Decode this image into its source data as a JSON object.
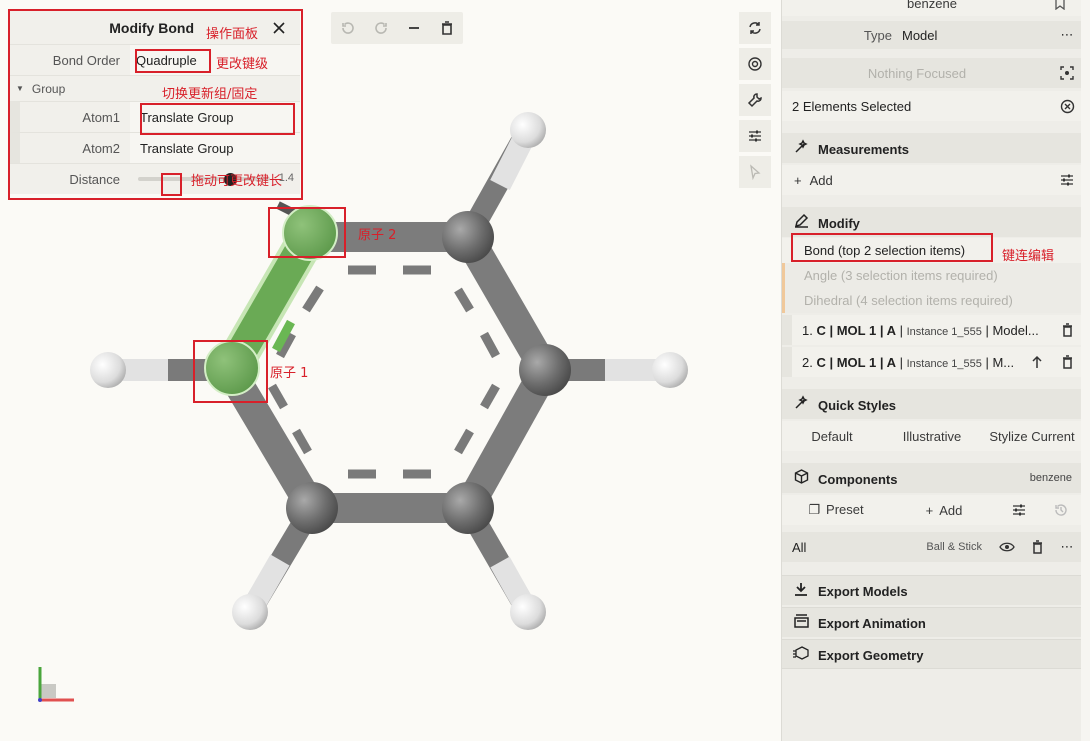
{
  "history": {
    "undo": "undo-icon",
    "redo": "redo-icon",
    "collapse": "minus-icon",
    "clear": "trash-icon"
  },
  "viewport_tools": [
    "reset-camera-icon",
    "screenshot-icon",
    "settings-wrench-icon",
    "controls-sliders-icon",
    "pointer-icon"
  ],
  "bond_panel": {
    "title": "Modify Bond",
    "bond_order_label": "Bond Order",
    "bond_order_value": "Quadruple",
    "group_label": "Group",
    "atom1_label": "Atom1",
    "atom1_value": "Translate Group",
    "atom2_label": "Atom2",
    "atom2_value": "Translate Group",
    "distance_label": "Distance",
    "distance_value": "1.4",
    "distance_fraction": 0.7
  },
  "annotations": {
    "panel": "操作面板",
    "bond_order": "更改键级",
    "group": "切换更新组/固定",
    "distance": "拖动可更改键长",
    "atom2": "原子 2",
    "atom1": "原子 1",
    "bond_edit": "键连编辑"
  },
  "side": {
    "top_label": "benzene",
    "type_label": "Type",
    "type_value": "Model",
    "focus": "Nothing Focused",
    "selected": "2 Elements Selected",
    "measurements": {
      "title": "Measurements",
      "add": "Add"
    },
    "modify": {
      "title": "Modify",
      "bond": "Bond (top 2 selection items)",
      "angle": "Angle (3 selection items required)",
      "dihedral": "Dihedral (4 selection items required)",
      "item1": {
        "num": "1.",
        "main": "C | MOL 1 | A",
        "sep": "|",
        "small": "Instance 1_555",
        "rest": "| Model..."
      },
      "item2": {
        "num": "2.",
        "main": "C | MOL 1 | A",
        "sep": "|",
        "small": "Instance 1_555",
        "rest": "| M..."
      }
    },
    "quick_styles": {
      "title": "Quick Styles",
      "default": "Default",
      "illustrative": "Illustrative",
      "stylize": "Stylize Current"
    },
    "components": {
      "title": "Components",
      "badge": "benzene",
      "preset": "Preset",
      "add": "Add",
      "all": "All",
      "repr": "Ball & Stick"
    },
    "export_models": "Export Models",
    "export_animation": "Export Animation",
    "export_geometry": "Export Geometry"
  }
}
